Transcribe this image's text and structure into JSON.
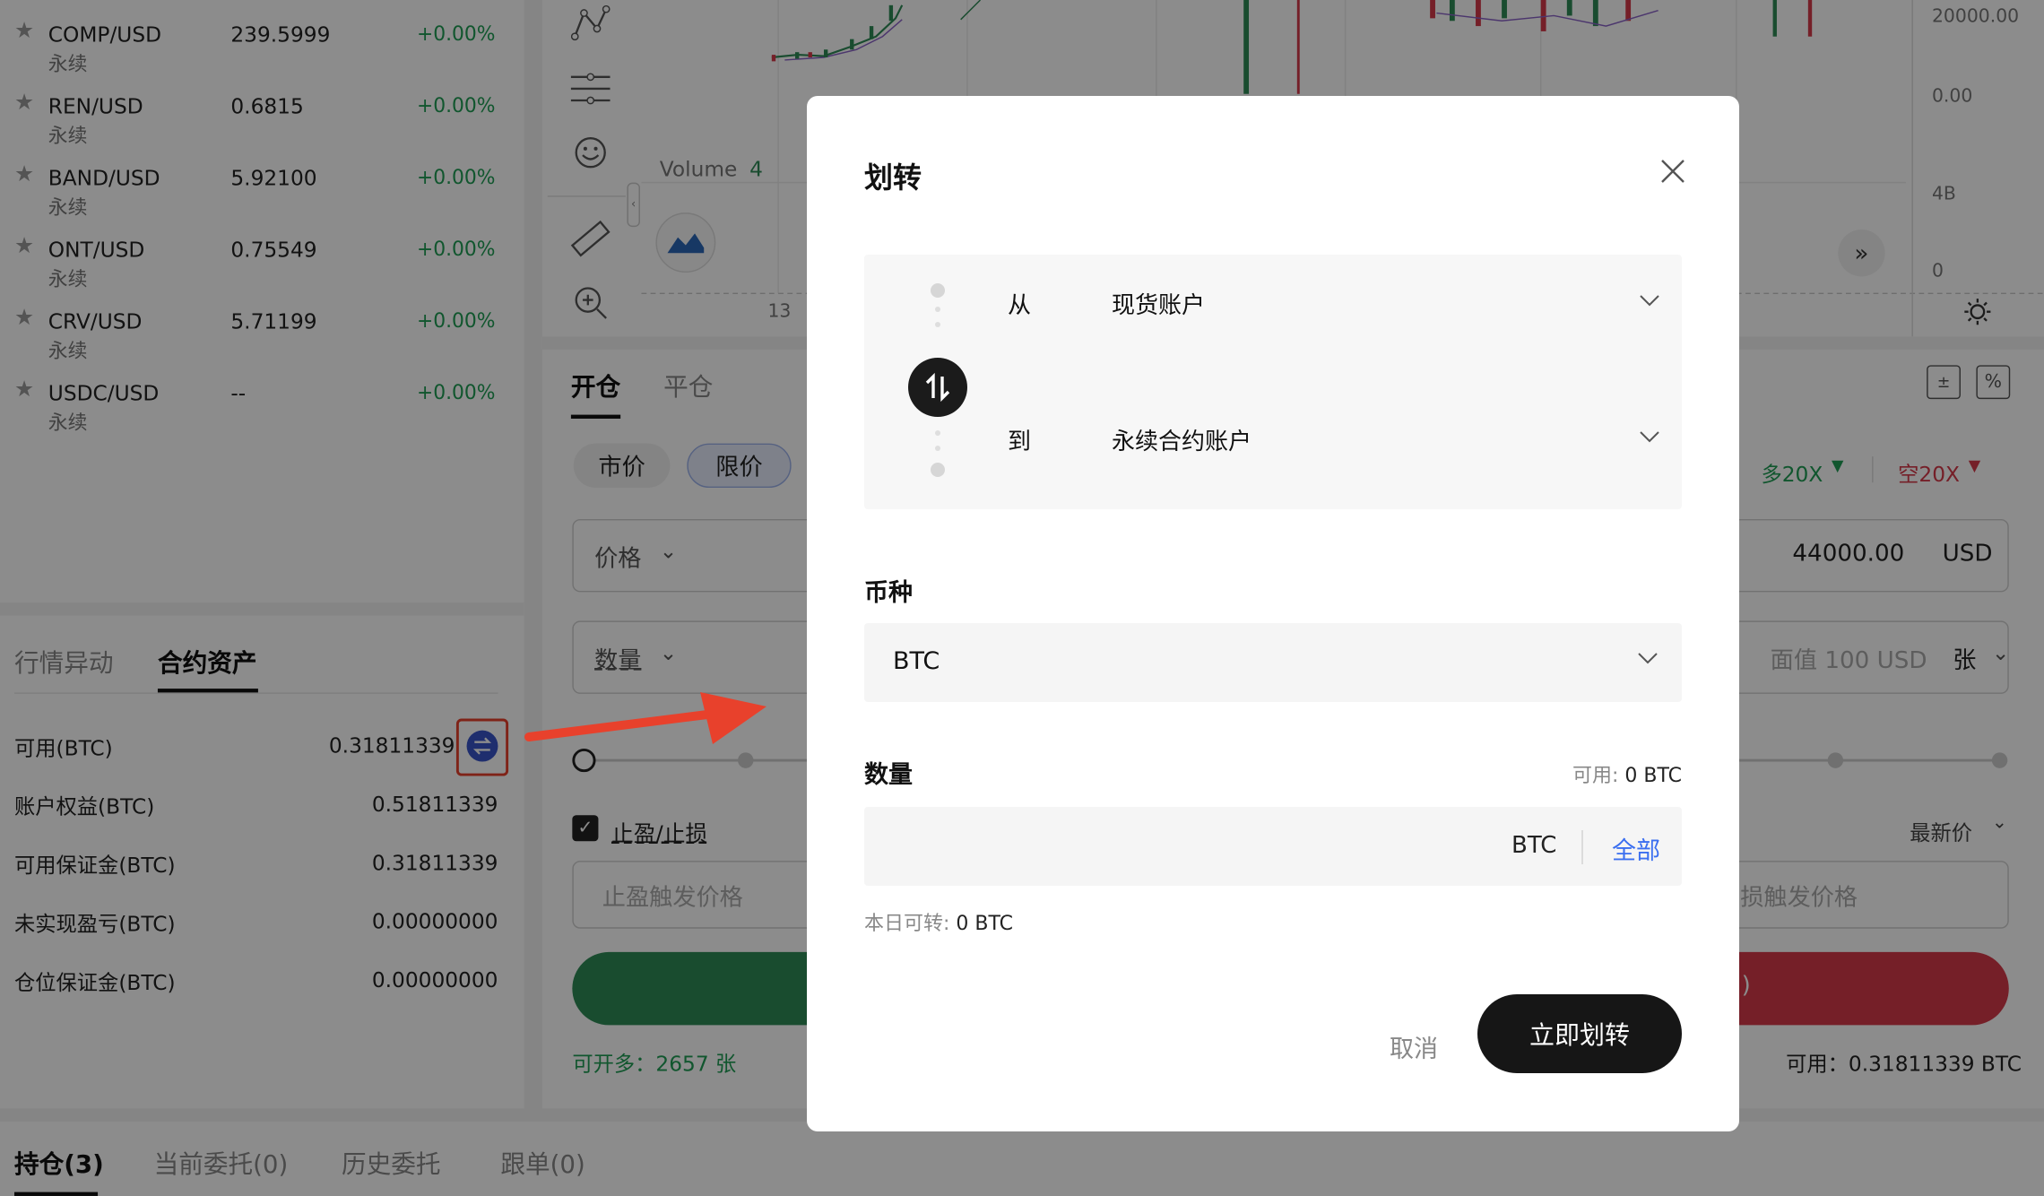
{
  "market_list": [
    {
      "symbol": "COMP/USD",
      "type": "永续",
      "price": "239.5999",
      "change": "+0.00%"
    },
    {
      "symbol": "REN/USD",
      "type": "永续",
      "price": "0.6815",
      "change": "+0.00%"
    },
    {
      "symbol": "BAND/USD",
      "type": "永续",
      "price": "5.92100",
      "change": "+0.00%"
    },
    {
      "symbol": "ONT/USD",
      "type": "永续",
      "price": "0.75549",
      "change": "+0.00%"
    },
    {
      "symbol": "CRV/USD",
      "type": "永续",
      "price": "5.71199",
      "change": "+0.00%"
    },
    {
      "symbol": "USDC/USD",
      "type": "永续",
      "price": "--",
      "change": "+0.00%"
    }
  ],
  "asset_panel": {
    "tabs": [
      "行情异动",
      "合约资产"
    ],
    "rows": [
      {
        "label": "可用(BTC)",
        "value": "0.31811339"
      },
      {
        "label": "账户权益(BTC)",
        "value": "0.51811339"
      },
      {
        "label": "可用保证金(BTC)",
        "value": "0.31811339"
      },
      {
        "label": "未实现盈亏(BTC)",
        "value": "0.00000000"
      },
      {
        "label": "仓位保证金(BTC)",
        "value": "0.00000000"
      }
    ]
  },
  "chart": {
    "volume_label": "Volume",
    "volume_value": "4",
    "y_ticks": [
      "20000.00",
      "0.00",
      "4B",
      "0"
    ],
    "x_tick": "13"
  },
  "order_panel": {
    "tabs": [
      "开仓",
      "平仓"
    ],
    "order_types": [
      "市价",
      "限价"
    ],
    "price_label": "价格",
    "price_value": "44000.00",
    "price_unit": "USD",
    "qty_label": "数量",
    "qty_hint": "面值 100 USD",
    "qty_unit": "张",
    "tpsl_label": "止盈/止损",
    "tp_placeholder": "止盈触发价格",
    "sl_placeholder": "损触发价格",
    "latest_price": "最新价",
    "long_leverage": "多20X",
    "short_leverage": "空20X",
    "short_btn_tail": ")",
    "can_open_long": "可开多：2657 张",
    "available": "可用：0.31811339 BTC"
  },
  "bottom_tabs": [
    "持仓(3)",
    "当前委托(0)",
    "历史委托",
    "跟单(0)"
  ],
  "modal": {
    "title": "划转",
    "from_label": "从",
    "from_account": "现货账户",
    "to_label": "到",
    "to_account": "永续合约账户",
    "coin_label": "币种",
    "coin_value": "BTC",
    "qty_label": "数量",
    "available_label": "可用:",
    "available_value": "0 BTC",
    "qty_placeholder": "",
    "qty_unit": "BTC",
    "all_label": "全部",
    "today_label": "本日可转:",
    "today_value": "0 BTC",
    "cancel_label": "取消",
    "confirm_label": "立即划转"
  },
  "colors": {
    "up_green": "#1f9d55",
    "down_red": "#d63a4a",
    "primary_dark": "#161616",
    "link_blue": "#3b6ff0",
    "annotation_red": "#e8412c"
  }
}
